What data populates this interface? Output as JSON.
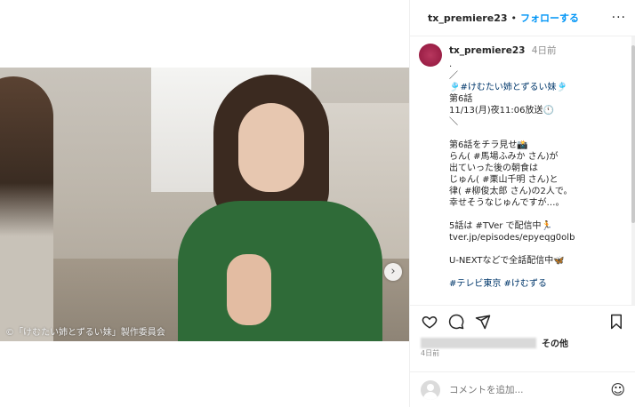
{
  "media": {
    "caption": "©「けむたい姉とずるい妹」製作委員会",
    "next_glyph": "›"
  },
  "header": {
    "username": "tx_premiere23",
    "separator": "•",
    "follow_label": "フォローする",
    "more_glyph": "···"
  },
  "post": {
    "username": "tx_premiere23",
    "time": "4日前",
    "lines": [
      ".",
      "／",
      "🎐#けむたい姉とずるい妹🎐",
      "第6話",
      "11/13(月)夜11:06放送🕚",
      "＼",
      "",
      "第6話をチラ見せ📸",
      "らん( #馬場ふみか さん)が",
      "出ていった後の朝食は",
      "じゅん( #栗山千明 さん)と",
      "律( #柳俊太郎 さん)の2人で。",
      "幸せそうなじゅんですが…。",
      "",
      "5話は #TVer で配信中🏃",
      "tver.jp/episodes/epyeqg0olb",
      "",
      "U-NEXTなどで全話配信中🦋",
      "",
      "#テレビ東京 #けむずる"
    ]
  },
  "likes": {
    "suffix": "その他"
  },
  "date_label": "4日前",
  "comment": {
    "placeholder": "コメントを追加...",
    "emoji_glyph": "☺"
  }
}
